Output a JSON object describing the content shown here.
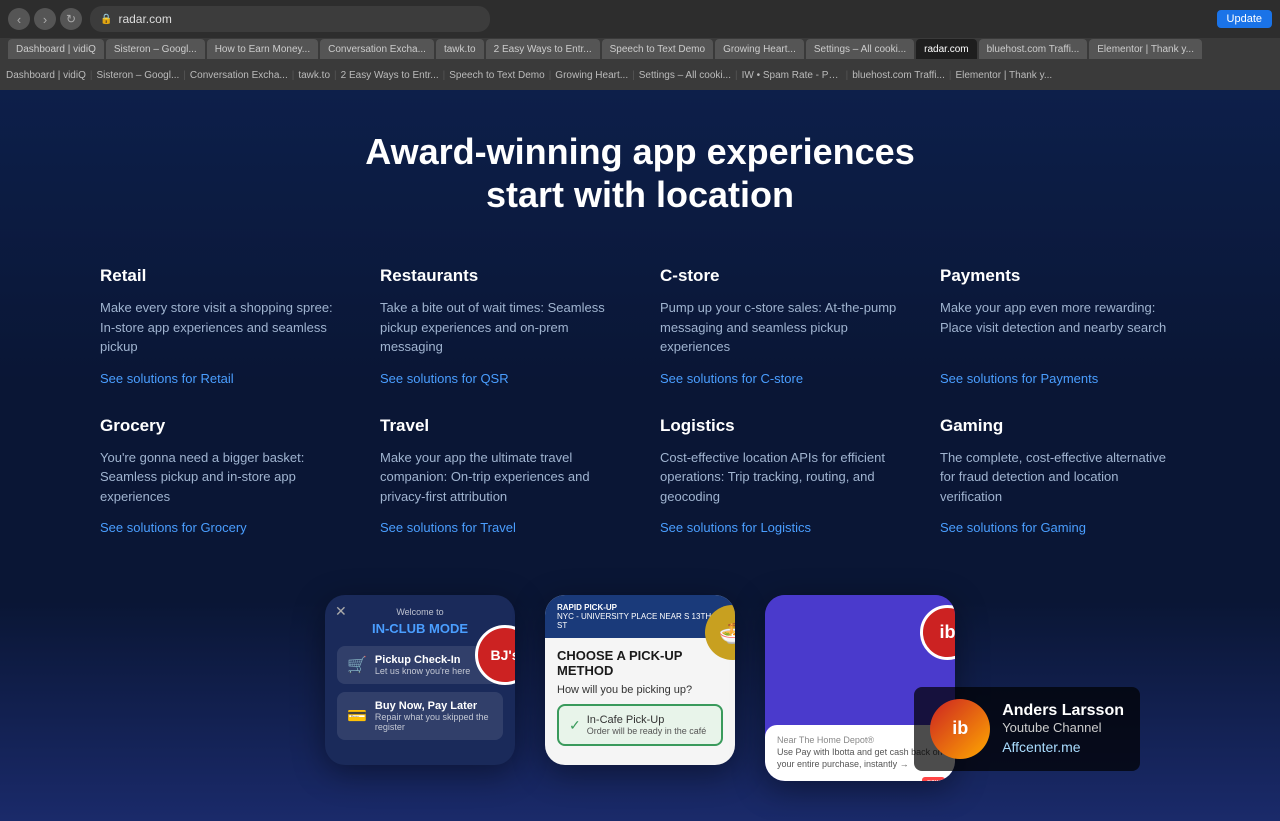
{
  "browser": {
    "address": "radar.com",
    "tabs": [
      {
        "label": "Dashboard | vidiQ",
        "active": false
      },
      {
        "label": "Sisteron – Googl...",
        "active": false
      },
      {
        "label": "How to Earn Money...",
        "active": false
      },
      {
        "label": "Conversation Excha...",
        "active": false
      },
      {
        "label": "tawk.to",
        "active": false
      },
      {
        "label": "2 Easy Ways to Entr...",
        "active": false
      },
      {
        "label": "Speech to Text Demo",
        "active": false
      },
      {
        "label": "Growing Heart...",
        "active": false
      },
      {
        "label": "Settings – All cooki...",
        "active": false
      },
      {
        "label": "IW • Spam Rate - Postm...",
        "active": false
      },
      {
        "label": "bluehost.com Traffi...",
        "active": false
      },
      {
        "label": "Elementor | Thank y...",
        "active": false
      }
    ],
    "update_label": "Update"
  },
  "page": {
    "heading_line1": "Award-winning app experiences",
    "heading_line2": "start with location"
  },
  "solutions": [
    {
      "id": "retail",
      "title": "Retail",
      "description": "Make every store visit a shopping spree: In-store app experiences and seamless pickup",
      "link": "See solutions for Retail"
    },
    {
      "id": "restaurants",
      "title": "Restaurants",
      "description": "Take a bite out of wait times: Seamless pickup experiences and on-prem messaging",
      "link": "See solutions for QSR"
    },
    {
      "id": "cstore",
      "title": "C-store",
      "description": "Pump up your c-store sales: At-the-pump messaging and seamless pickup experiences",
      "link": "See solutions for C-store"
    },
    {
      "id": "payments",
      "title": "Payments",
      "description": "Make your app even more rewarding: Place visit detection and nearby search",
      "link": "See solutions for Payments"
    },
    {
      "id": "grocery",
      "title": "Grocery",
      "description": "You're gonna need a bigger basket: Seamless pickup and in-store app experiences",
      "link": "See solutions for Grocery"
    },
    {
      "id": "travel",
      "title": "Travel",
      "description": "Make your app the ultimate travel companion: On-trip experiences and privacy-first attribution",
      "link": "See solutions for Travel"
    },
    {
      "id": "logistics",
      "title": "Logistics",
      "description": "Cost-effective location APIs for efficient operations: Trip tracking, routing, and geocoding",
      "link": "See solutions for Logistics"
    },
    {
      "id": "gaming",
      "title": "Gaming",
      "description": "The complete, cost-effective alternative for fraud detection and location verification",
      "link": "See solutions for Gaming"
    }
  ],
  "mockups": {
    "left": {
      "welcome": "Welcome to",
      "mode": "IN-CLUB MODE",
      "logo": "BJ's",
      "items": [
        {
          "icon": "🛒",
          "label": "Pickup Check-In",
          "sub": "Let us know you're here"
        },
        {
          "icon": "💳",
          "label": "Buy Now, Pay Later",
          "sub": "Repair what you skipped the register"
        }
      ]
    },
    "center": {
      "top": "NYC - UNIVERSITY PLACE NEAR S 13TH ST",
      "rapid_pickup": "RAPID PICK-UP",
      "heading": "CHOOSE A PICK-UP METHOD",
      "question": "How will you be picking up?",
      "option": "In-Cafe Pick-Up",
      "option_sub": "Order will be ready in the café",
      "food_badge": "🍜"
    },
    "right": {
      "badge_text": "ib",
      "near_label": "Near The Home Depot®",
      "near_sub": "Use Pay with Ibotta and get cash back on your entire purchase, instantly →",
      "new_label": "new"
    }
  },
  "overlay": {
    "name": "Anders Larsson",
    "channel": "Youtube Channel",
    "brand": "Affcenter.me",
    "avatar_icon": "ib"
  }
}
